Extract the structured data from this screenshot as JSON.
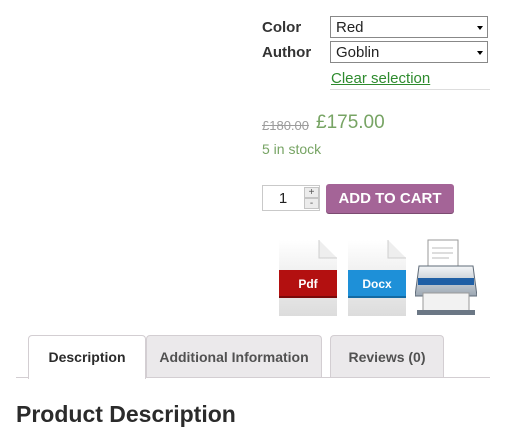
{
  "variations": {
    "color": {
      "label": "Color",
      "selected": "Red"
    },
    "author": {
      "label": "Author",
      "selected": "Goblin"
    },
    "clear_label": "Clear selection"
  },
  "price": {
    "old": "£180.00",
    "current": "£175.00",
    "stock": "5 in stock"
  },
  "cart": {
    "quantity": "1",
    "plus": "+",
    "minus": "-",
    "add_label": "ADD TO CART"
  },
  "downloads": {
    "pdf_label": "Pdf",
    "docx_label": "Docx",
    "pdf_color": "#b31010",
    "docx_color": "#1e90d8",
    "print_icon": "printer-icon"
  },
  "tabs": [
    {
      "label": "Description",
      "active": true
    },
    {
      "label": "Additional Information",
      "active": false
    },
    {
      "label": "Reviews (0)",
      "active": false
    }
  ],
  "content": {
    "heading": "Product Description"
  },
  "colors": {
    "accent": "#a46497",
    "price": "#77a464",
    "link": "#2e8b2e"
  }
}
